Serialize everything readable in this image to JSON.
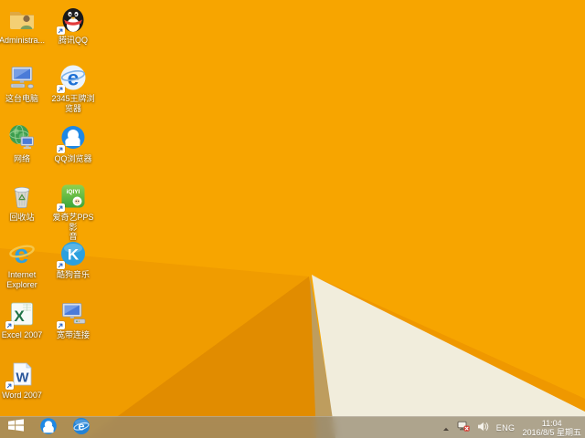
{
  "wallpaper": {
    "colors": {
      "background": "#F7A500",
      "facet_mid": "#F09C00",
      "facet_dark": "#E18C00",
      "shadow_sliver": "#BE9D5E",
      "ridge_stripe": "#EF9800",
      "cream": "#F1EDDC"
    }
  },
  "desktop": {
    "icons": [
      {
        "name": "administrator-folder",
        "icon": "user-folder-icon",
        "label": "Administra..."
      },
      {
        "name": "tencent-qq",
        "icon": "qq-penguin-icon",
        "label": "腾讯QQ",
        "shortcut": true
      },
      {
        "name": "this-pc",
        "icon": "computer-icon",
        "label": "这台电脑"
      },
      {
        "name": "2345-browser",
        "icon": "browser-e-icon",
        "label": "2345王牌浏\n览器",
        "glyph": "e",
        "shortcut": true
      },
      {
        "name": "network",
        "icon": "globe-network-icon",
        "label": "网络"
      },
      {
        "name": "qq-browser",
        "icon": "qq-browser-cloud-icon",
        "label": "QQ浏览器",
        "shortcut": true
      },
      {
        "name": "recycle-bin",
        "icon": "recycle-bin-icon",
        "label": "回收站"
      },
      {
        "name": "iqiyi-pps",
        "icon": "iqiyi-pps-icon",
        "label": "爱奇艺PPS 影\n音",
        "logo_text": "iQIYI",
        "shortcut": true
      },
      {
        "name": "internet-explorer",
        "icon": "ie-e-icon",
        "label": "Internet\nExplorer",
        "glyph": "e"
      },
      {
        "name": "kugou-music",
        "icon": "kugou-k-icon",
        "label": "酷狗音乐",
        "glyph": "K",
        "shortcut": true
      },
      {
        "name": "excel-2007",
        "icon": "excel-icon",
        "label": "Excel 2007",
        "glyph": "X",
        "shortcut": true
      },
      {
        "name": "broadband-connection",
        "icon": "broadband-modem-icon",
        "label": "宽带连接",
        "shortcut": true
      },
      {
        "name": "word-2007",
        "icon": "word-icon",
        "label": "Word 2007",
        "glyph": "W",
        "shortcut": true
      }
    ]
  },
  "taskbar": {
    "start_icon": "windows-logo",
    "pinned": [
      {
        "name": "qq-browser",
        "icon": "qq-browser-cloud-icon"
      },
      {
        "name": "internet-explorer",
        "icon": "ie-e-icon",
        "glyph": "e"
      }
    ],
    "tray": {
      "hidden_icons": "chevron-up",
      "network_icon": "network-disconnected",
      "volume_icon": "speaker",
      "language": "ENG",
      "time": "11:04",
      "date": "2016/8/5 星期五"
    }
  }
}
